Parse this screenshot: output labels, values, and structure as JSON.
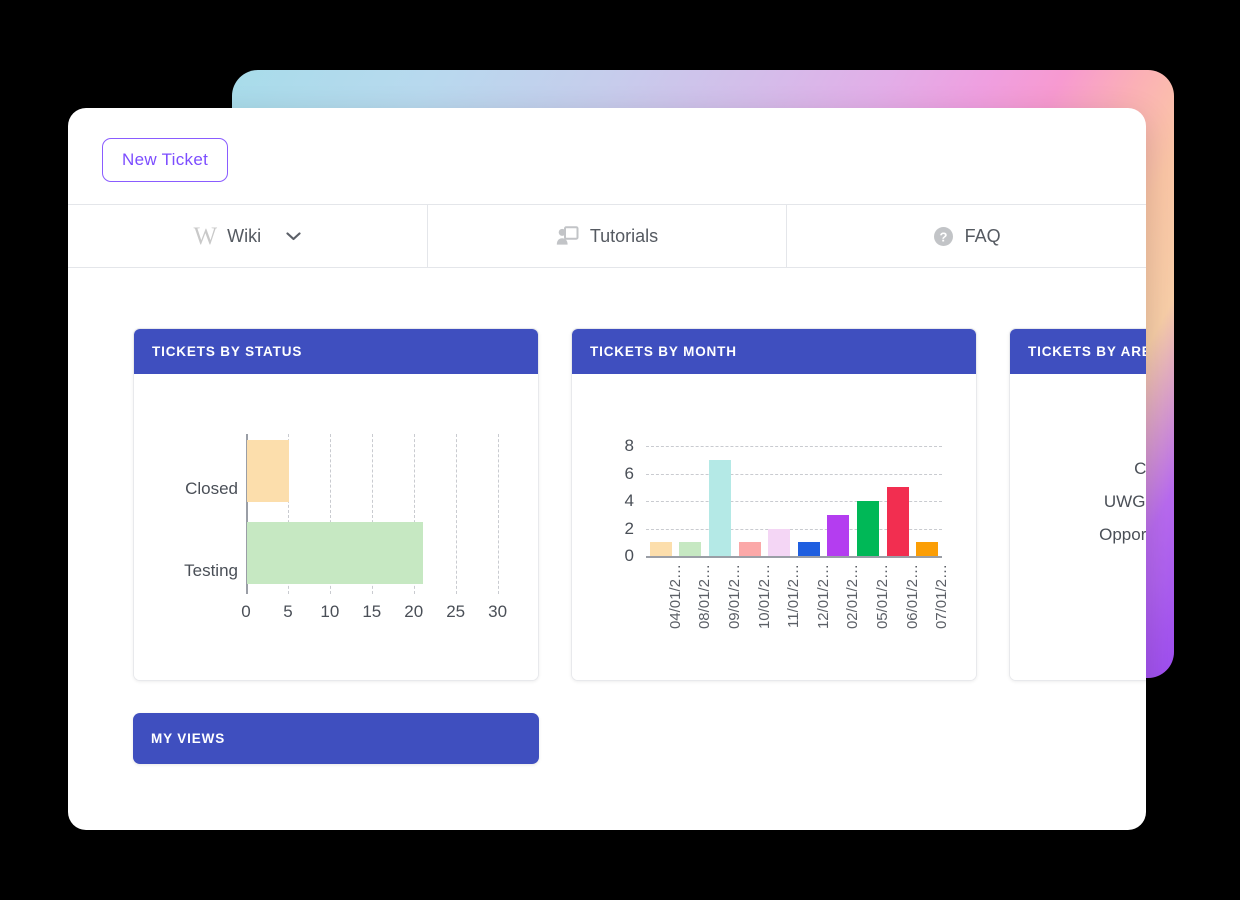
{
  "toolbar": {
    "new_ticket_label": "New Ticket"
  },
  "tabs": [
    {
      "label": "Wiki",
      "icon": "wikipedia-w-icon",
      "has_caret": true,
      "caret": "⌄"
    },
    {
      "label": "Tutorials",
      "icon": "presentation-person-icon",
      "has_caret": false
    },
    {
      "label": "FAQ",
      "icon": "question-circle-icon",
      "has_caret": false
    }
  ],
  "cards": [
    {
      "title": "TICKETS BY STATUS"
    },
    {
      "title": "TICKETS BY MONTH"
    },
    {
      "title": "TICKETS BY AREA"
    }
  ],
  "my_views": {
    "title": "MY VIEWS"
  },
  "area_card": {
    "labels": [
      "Cam",
      "UWGNH",
      "Opportun"
    ]
  },
  "colors": {
    "accent_purple": "#7c4dff",
    "card_header_blue": "#3f4fbf",
    "text_dark": "#4a4f57"
  },
  "chart_data": [
    {
      "type": "bar",
      "orientation": "horizontal",
      "title": "TICKETS BY STATUS",
      "categories": [
        "Closed",
        "Testing"
      ],
      "values": [
        5,
        21
      ],
      "colors": [
        "#fcdeac",
        "#c6e8c2"
      ],
      "xlabel": "",
      "ylabel": "",
      "xlim": [
        0,
        31
      ],
      "xticks": [
        0,
        5,
        10,
        15,
        20,
        25,
        30
      ],
      "grid": true,
      "legend": false
    },
    {
      "type": "bar",
      "orientation": "vertical",
      "title": "TICKETS BY MONTH",
      "categories": [
        "04/01/2…",
        "08/01/2…",
        "09/01/2…",
        "10/01/2…",
        "11/01/2…",
        "12/01/2…",
        "02/01/2…",
        "05/01/2…",
        "06/01/2…",
        "07/01/2…"
      ],
      "values": [
        1,
        1,
        7,
        1,
        2,
        1,
        3,
        4,
        5,
        1
      ],
      "colors": [
        "#fcdeac",
        "#c6e8c2",
        "#b4e9e6",
        "#fba8a8",
        "#f4d6f5",
        "#1f5fe0",
        "#b43df0",
        "#00b857",
        "#f22e50",
        "#fb9e06"
      ],
      "xlabel": "",
      "ylabel": "",
      "ylim": [
        0,
        8
      ],
      "yticks": [
        0,
        2,
        4,
        6,
        8
      ],
      "grid": true,
      "legend": false
    },
    {
      "type": "bar",
      "orientation": "horizontal",
      "title": "TICKETS BY AREA",
      "categories": [
        "Cam",
        "UWGNH",
        "Opportun"
      ],
      "values": [],
      "note": "card is clipped by the window edge; bars are not visible",
      "grid": false,
      "legend": false
    }
  ]
}
